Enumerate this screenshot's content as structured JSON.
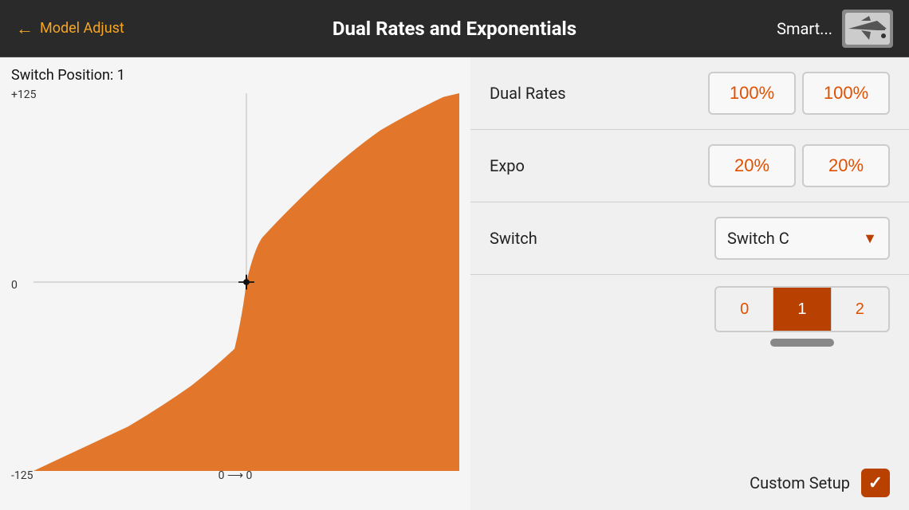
{
  "header": {
    "back_label": "Model Adjust",
    "title": "Dual Rates and Exponentials",
    "smart_label": "Smart...",
    "back_arrow": "←"
  },
  "graph": {
    "switch_position_label": "Switch Position: 1",
    "y_top": "+125",
    "y_zero": "0",
    "y_bottom": "-125",
    "x_label": "0 ⟶ 0"
  },
  "dual_rates": {
    "label": "Dual Rates",
    "value1": "100%",
    "value2": "100%"
  },
  "expo": {
    "label": "Expo",
    "value1": "20%",
    "value2": "20%"
  },
  "switch": {
    "label": "Switch",
    "selected": "Switch C",
    "caret": "▼",
    "positions": [
      "0",
      "1",
      "2"
    ],
    "active_position": 1
  },
  "custom_setup": {
    "label": "Custom Setup",
    "checked": true
  }
}
